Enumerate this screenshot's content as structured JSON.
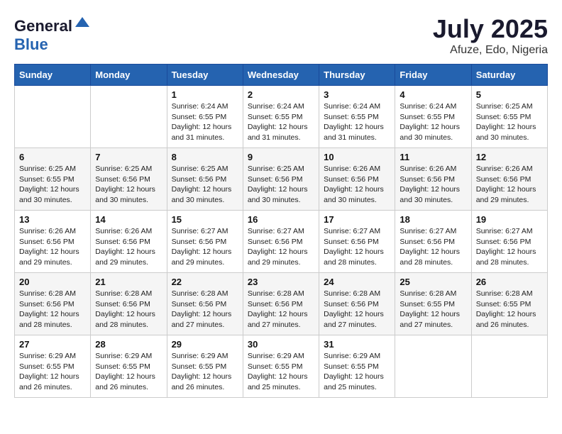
{
  "header": {
    "logo_general": "General",
    "logo_blue": "Blue",
    "month_title": "July 2025",
    "location": "Afuze, Edo, Nigeria"
  },
  "columns": [
    "Sunday",
    "Monday",
    "Tuesday",
    "Wednesday",
    "Thursday",
    "Friday",
    "Saturday"
  ],
  "weeks": [
    [
      {
        "day": "",
        "info": ""
      },
      {
        "day": "",
        "info": ""
      },
      {
        "day": "1",
        "info": "Sunrise: 6:24 AM\nSunset: 6:55 PM\nDaylight: 12 hours and 31 minutes."
      },
      {
        "day": "2",
        "info": "Sunrise: 6:24 AM\nSunset: 6:55 PM\nDaylight: 12 hours and 31 minutes."
      },
      {
        "day": "3",
        "info": "Sunrise: 6:24 AM\nSunset: 6:55 PM\nDaylight: 12 hours and 31 minutes."
      },
      {
        "day": "4",
        "info": "Sunrise: 6:24 AM\nSunset: 6:55 PM\nDaylight: 12 hours and 30 minutes."
      },
      {
        "day": "5",
        "info": "Sunrise: 6:25 AM\nSunset: 6:55 PM\nDaylight: 12 hours and 30 minutes."
      }
    ],
    [
      {
        "day": "6",
        "info": "Sunrise: 6:25 AM\nSunset: 6:55 PM\nDaylight: 12 hours and 30 minutes."
      },
      {
        "day": "7",
        "info": "Sunrise: 6:25 AM\nSunset: 6:56 PM\nDaylight: 12 hours and 30 minutes."
      },
      {
        "day": "8",
        "info": "Sunrise: 6:25 AM\nSunset: 6:56 PM\nDaylight: 12 hours and 30 minutes."
      },
      {
        "day": "9",
        "info": "Sunrise: 6:25 AM\nSunset: 6:56 PM\nDaylight: 12 hours and 30 minutes."
      },
      {
        "day": "10",
        "info": "Sunrise: 6:26 AM\nSunset: 6:56 PM\nDaylight: 12 hours and 30 minutes."
      },
      {
        "day": "11",
        "info": "Sunrise: 6:26 AM\nSunset: 6:56 PM\nDaylight: 12 hours and 30 minutes."
      },
      {
        "day": "12",
        "info": "Sunrise: 6:26 AM\nSunset: 6:56 PM\nDaylight: 12 hours and 29 minutes."
      }
    ],
    [
      {
        "day": "13",
        "info": "Sunrise: 6:26 AM\nSunset: 6:56 PM\nDaylight: 12 hours and 29 minutes."
      },
      {
        "day": "14",
        "info": "Sunrise: 6:26 AM\nSunset: 6:56 PM\nDaylight: 12 hours and 29 minutes."
      },
      {
        "day": "15",
        "info": "Sunrise: 6:27 AM\nSunset: 6:56 PM\nDaylight: 12 hours and 29 minutes."
      },
      {
        "day": "16",
        "info": "Sunrise: 6:27 AM\nSunset: 6:56 PM\nDaylight: 12 hours and 29 minutes."
      },
      {
        "day": "17",
        "info": "Sunrise: 6:27 AM\nSunset: 6:56 PM\nDaylight: 12 hours and 28 minutes."
      },
      {
        "day": "18",
        "info": "Sunrise: 6:27 AM\nSunset: 6:56 PM\nDaylight: 12 hours and 28 minutes."
      },
      {
        "day": "19",
        "info": "Sunrise: 6:27 AM\nSunset: 6:56 PM\nDaylight: 12 hours and 28 minutes."
      }
    ],
    [
      {
        "day": "20",
        "info": "Sunrise: 6:28 AM\nSunset: 6:56 PM\nDaylight: 12 hours and 28 minutes."
      },
      {
        "day": "21",
        "info": "Sunrise: 6:28 AM\nSunset: 6:56 PM\nDaylight: 12 hours and 28 minutes."
      },
      {
        "day": "22",
        "info": "Sunrise: 6:28 AM\nSunset: 6:56 PM\nDaylight: 12 hours and 27 minutes."
      },
      {
        "day": "23",
        "info": "Sunrise: 6:28 AM\nSunset: 6:56 PM\nDaylight: 12 hours and 27 minutes."
      },
      {
        "day": "24",
        "info": "Sunrise: 6:28 AM\nSunset: 6:56 PM\nDaylight: 12 hours and 27 minutes."
      },
      {
        "day": "25",
        "info": "Sunrise: 6:28 AM\nSunset: 6:55 PM\nDaylight: 12 hours and 27 minutes."
      },
      {
        "day": "26",
        "info": "Sunrise: 6:28 AM\nSunset: 6:55 PM\nDaylight: 12 hours and 26 minutes."
      }
    ],
    [
      {
        "day": "27",
        "info": "Sunrise: 6:29 AM\nSunset: 6:55 PM\nDaylight: 12 hours and 26 minutes."
      },
      {
        "day": "28",
        "info": "Sunrise: 6:29 AM\nSunset: 6:55 PM\nDaylight: 12 hours and 26 minutes."
      },
      {
        "day": "29",
        "info": "Sunrise: 6:29 AM\nSunset: 6:55 PM\nDaylight: 12 hours and 26 minutes."
      },
      {
        "day": "30",
        "info": "Sunrise: 6:29 AM\nSunset: 6:55 PM\nDaylight: 12 hours and 25 minutes."
      },
      {
        "day": "31",
        "info": "Sunrise: 6:29 AM\nSunset: 6:55 PM\nDaylight: 12 hours and 25 minutes."
      },
      {
        "day": "",
        "info": ""
      },
      {
        "day": "",
        "info": ""
      }
    ]
  ]
}
